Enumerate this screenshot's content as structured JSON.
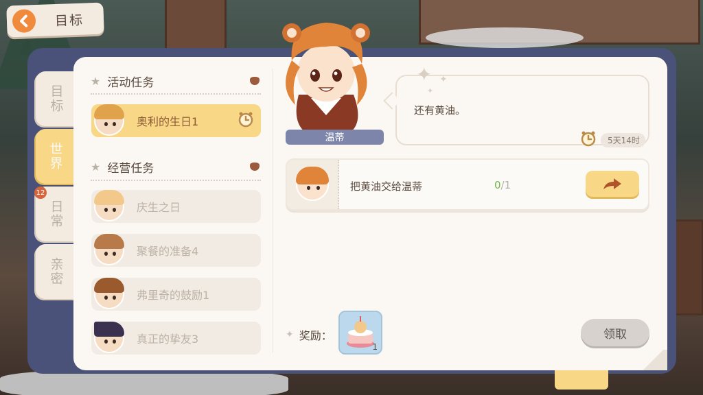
{
  "header": {
    "back_title": "目标"
  },
  "tabs": [
    {
      "label": "目标",
      "active": false
    },
    {
      "label": "世界",
      "active": true
    },
    {
      "label": "日常",
      "active": false,
      "badge": "12"
    },
    {
      "label": "亲密",
      "active": false
    }
  ],
  "sections": {
    "event": {
      "title": "活动任务"
    },
    "business": {
      "title": "经营任务"
    }
  },
  "quests": [
    {
      "label": "奥利的生日1",
      "active": true,
      "hair": "#e0a24a",
      "has_clock": true
    },
    {
      "label": "庆生之日",
      "active": false,
      "hair": "#f2c98a"
    },
    {
      "label": "聚餐的准备4",
      "active": false,
      "hair": "#b87a4a"
    },
    {
      "label": "弗里奇的鼓励1",
      "active": false,
      "hair": "#9a5a2e"
    },
    {
      "label": "真正的挚友3",
      "active": false,
      "hair": "#3a3050"
    }
  ],
  "character": {
    "name": "温蒂"
  },
  "dialog": {
    "text": "还有黄油。",
    "time_left": "5天14时"
  },
  "objective": {
    "text": "把黄油交给温蒂",
    "current": "0",
    "separator": "/",
    "total": "1"
  },
  "reward": {
    "label": "奖励：",
    "quantity": "1"
  },
  "claim_button": "领取",
  "colors": {
    "accent_yellow": "#f8d886",
    "frame_blue": "#4a527a",
    "name_tag": "#7d86aa",
    "progress_green": "#6fb84a",
    "back_orange": "#f08a3c"
  }
}
